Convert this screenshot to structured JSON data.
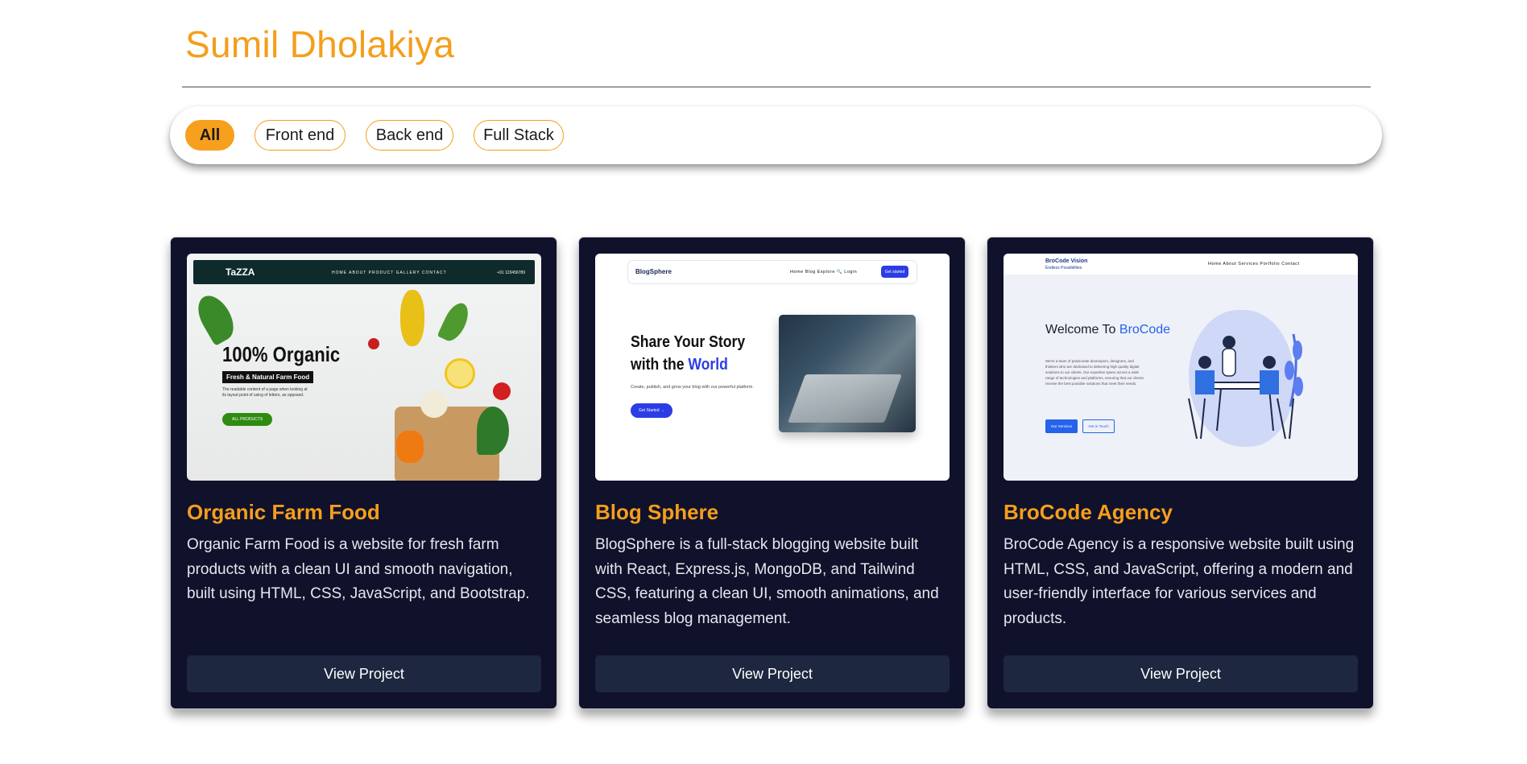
{
  "header": {
    "title": "Sumil Dholakiya"
  },
  "filters": [
    {
      "label": "All",
      "active": true
    },
    {
      "label": "Front end",
      "active": false
    },
    {
      "label": "Back end",
      "active": false
    },
    {
      "label": "Full Stack",
      "active": false
    }
  ],
  "projects": [
    {
      "title": "Organic Farm Food",
      "description": "Organic Farm Food is a website for fresh farm products with a clean UI and smooth navigation, built using HTML, CSS, JavaScript, and Bootstrap.",
      "button": "View Project",
      "thumb": {
        "logo": "TaZZA",
        "nav": "HOME ABOUT PRODUCT GALLERY CONTACT",
        "phone": "+91 123456789",
        "headline": "100% Organic",
        "sub": "Fresh & Natural Farm Food",
        "text": "The readable content of a page when looking at its layout point of using of letters, as opposed.",
        "cta": "ALL PRODUCTS"
      }
    },
    {
      "title": "Blog Sphere",
      "description": "BlogSphere is a full-stack blogging website built with React, Express.js, MongoDB, and Tailwind CSS, featuring a clean UI, smooth animations, and seamless blog management.",
      "button": "View Project",
      "thumb": {
        "logo": "BlogSphere",
        "nav": "Home  Blog  Explore  🔍  Login",
        "nav_button": "Get started",
        "headline_1": "Share Your Story",
        "headline_2": "with the ",
        "headline_accent": "World",
        "text": "Create, publish, and grow your blog with our powerful platform.",
        "cta": "Get Started →"
      }
    },
    {
      "title": "BroCode Agency",
      "description": "BroCode Agency is a responsive website built using HTML, CSS, and JavaScript, offering a modern and user-friendly interface for various services and products.",
      "button": "View Project",
      "thumb": {
        "logo": "BroCode Vision",
        "logo_sub": "Endless Possibilities",
        "nav": "Home  About  Services  Portfolio  Contact",
        "headline": "Welcome To ",
        "headline_accent": "BroCode",
        "text": "We're a team of passionate developers, designers, and thinkers who are dedicated to delivering high quality digital solutions to our clients. Our expertise spans across a wide range of technologies and platforms, ensuring that our clients receive the best possible solutions that meet their needs.",
        "cta_1": "Our Services",
        "cta_2": "Get in Touch"
      }
    }
  ],
  "colors": {
    "accent": "#f59e1b",
    "card_bg": "#10112a",
    "button_bg": "#1d2740"
  }
}
